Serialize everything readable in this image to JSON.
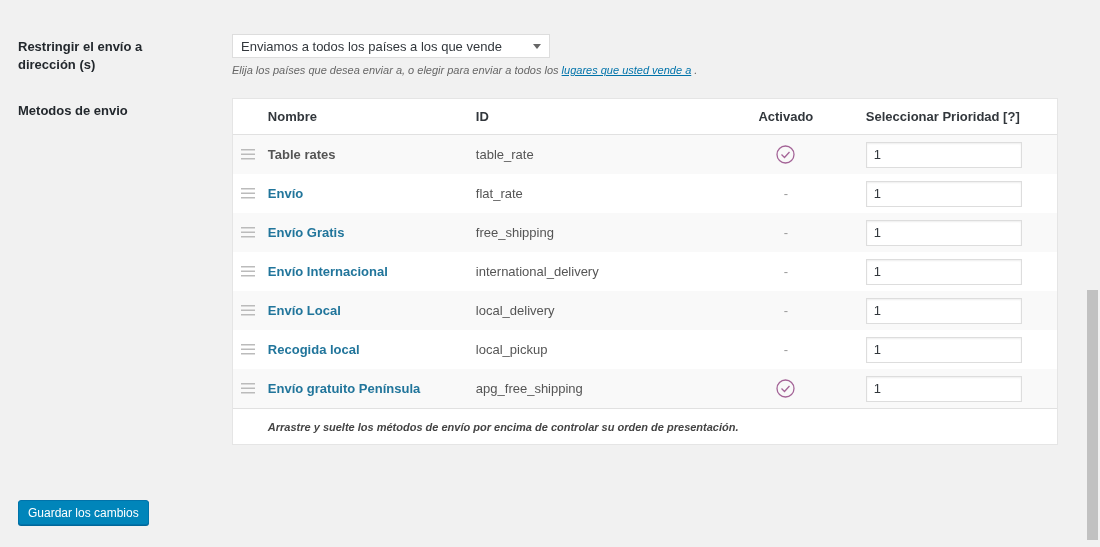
{
  "restrict": {
    "label": "Restringir el envío a dirección (s)",
    "select_value": "Enviamos a todos los países a los que vende",
    "help_text": "Elija los países que desea enviar a, o elegir para enviar a todos los",
    "help_link": "lugares que usted vende a",
    "help_end": "."
  },
  "methods": {
    "label": "Metodos de envio",
    "columns": [
      "Nombre",
      "ID",
      "Activado",
      "Seleccionar Prioridad [?]"
    ],
    "rows": [
      {
        "name": "Table rates",
        "linked": false,
        "id": "table_rate",
        "enabled": true,
        "priority": "1"
      },
      {
        "name": "Envío",
        "linked": true,
        "id": "flat_rate",
        "enabled": false,
        "status_text": "-",
        "priority": "1"
      },
      {
        "name": "Envío Gratis",
        "linked": true,
        "id": "free_shipping",
        "enabled": false,
        "status_text": "-",
        "priority": "1"
      },
      {
        "name": "Envío Internacional",
        "linked": true,
        "id": "international_delivery",
        "enabled": false,
        "status_text": "-",
        "priority": "1"
      },
      {
        "name": "Envío Local",
        "linked": true,
        "id": "local_delivery",
        "enabled": false,
        "status_text": "-",
        "priority": "1"
      },
      {
        "name": "Recogida local",
        "linked": true,
        "id": "local_pickup",
        "enabled": false,
        "status_text": "-",
        "priority": "1"
      },
      {
        "name": "Envío gratuito Península",
        "linked": true,
        "id": "apg_free_shipping",
        "enabled": true,
        "priority": "1"
      }
    ],
    "footer": "Arrastre y suelte los métodos de envío por encima de controlar su orden de presentación."
  },
  "save_button": "Guardar los cambios"
}
